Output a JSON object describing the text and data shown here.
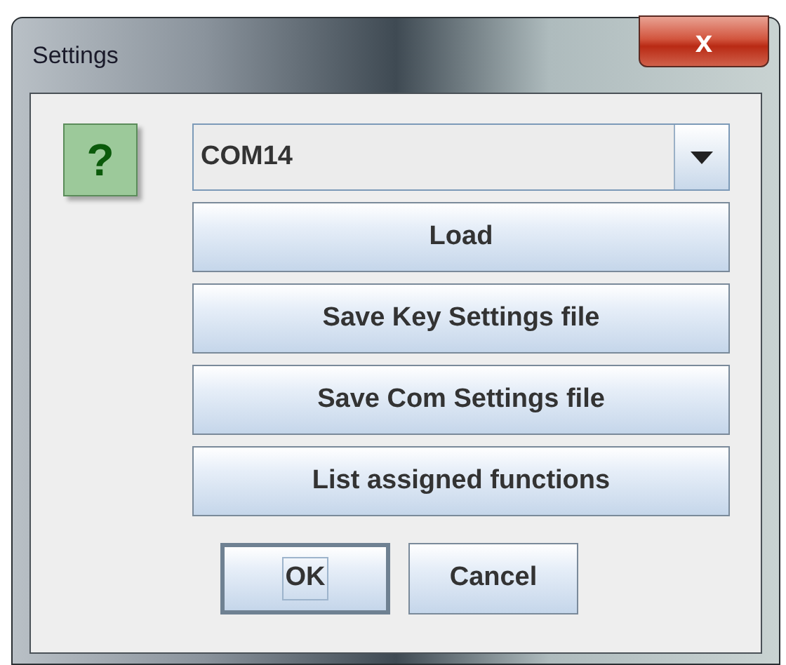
{
  "window": {
    "title": "Settings",
    "close": "x"
  },
  "help_icon": "?",
  "port_combo": {
    "value": "COM14"
  },
  "actions": [
    {
      "label": "Load"
    },
    {
      "label": "Save Key Settings file"
    },
    {
      "label": "Save Com Settings file"
    },
    {
      "label": "List assigned functions"
    }
  ],
  "buttons": [
    {
      "label": "OK",
      "focused": true
    },
    {
      "label": "Cancel",
      "focused": false
    }
  ]
}
